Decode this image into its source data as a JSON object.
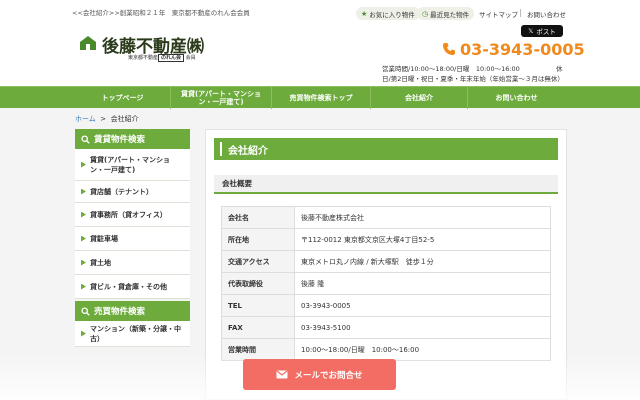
{
  "topbar": {
    "tagline": "<<会社紹介>>創業昭和２１年　東京都不動産のれん会会員",
    "favorite_label": "お気に入り物件",
    "recent_label": "最近見た物件",
    "sitemap_label": "サイトマップ",
    "contact_label": "お問い合わせ"
  },
  "header": {
    "logo_title": "後藤不動産㈱",
    "logo_sub_prefix": "東京都不動産",
    "logo_sub_mark": "のれん会",
    "logo_sub_suffix": "会員",
    "tweet_label": "ポスト",
    "phone": "03-3943-0005",
    "hours_line1": "営業時間/10:00～18:00/日曜　10:00～16:00",
    "hours_line1_tail": "休",
    "hours_line2": "日/第2日曜・祝日・夏季・年末年始（年始営業～３月は無休）",
    "colors": {
      "accent": "#6cab3c",
      "phone": "#f08a1d",
      "mail_button": "#f26d63"
    }
  },
  "nav": {
    "items": [
      {
        "label": "トップページ"
      },
      {
        "label": "賃貸(アパート・マンション・一戸建て)"
      },
      {
        "label": "売買物件検索トップ"
      },
      {
        "label": "会社紹介"
      },
      {
        "label": "お問い合わせ"
      }
    ]
  },
  "breadcrumb": {
    "home": "ホーム",
    "sep": ">",
    "current": "会社紹介"
  },
  "sidebar": {
    "rental_heading": "賃貸物件検索",
    "rental_items": [
      {
        "label": "賃貸(アパート・マンション・一戸建て)"
      },
      {
        "label": "貸店舗（テナント）"
      },
      {
        "label": "貸事務所（貸オフィス）"
      },
      {
        "label": "貸駐車場"
      },
      {
        "label": "貸土地"
      },
      {
        "label": "貸ビル・貸倉庫・その他"
      }
    ],
    "sale_heading": "売買物件検索",
    "sale_items": [
      {
        "label": "マンション（新築・分譲・中古）"
      }
    ]
  },
  "main": {
    "title": "会社紹介",
    "section_title": "会社概要",
    "rows": [
      {
        "key": "会社名",
        "value": "後藤不動産株式会社"
      },
      {
        "key": "所在地",
        "value": "〒112-0012 東京都文京区大塚4丁目52-5"
      },
      {
        "key": "交通アクセス",
        "value": "東京メトロ丸ノ内線 / 新大塚駅　徒歩１分"
      },
      {
        "key": "代表取締役",
        "value": "後藤 隆"
      },
      {
        "key": "TEL",
        "value": "03-3943-0005"
      },
      {
        "key": "FAX",
        "value": "03-3943-5100"
      },
      {
        "key": "営業時間",
        "value": "10:00～18:00/日曜　10:00～16:00"
      }
    ]
  },
  "mail_button": {
    "label": "メールでお問合せ"
  }
}
